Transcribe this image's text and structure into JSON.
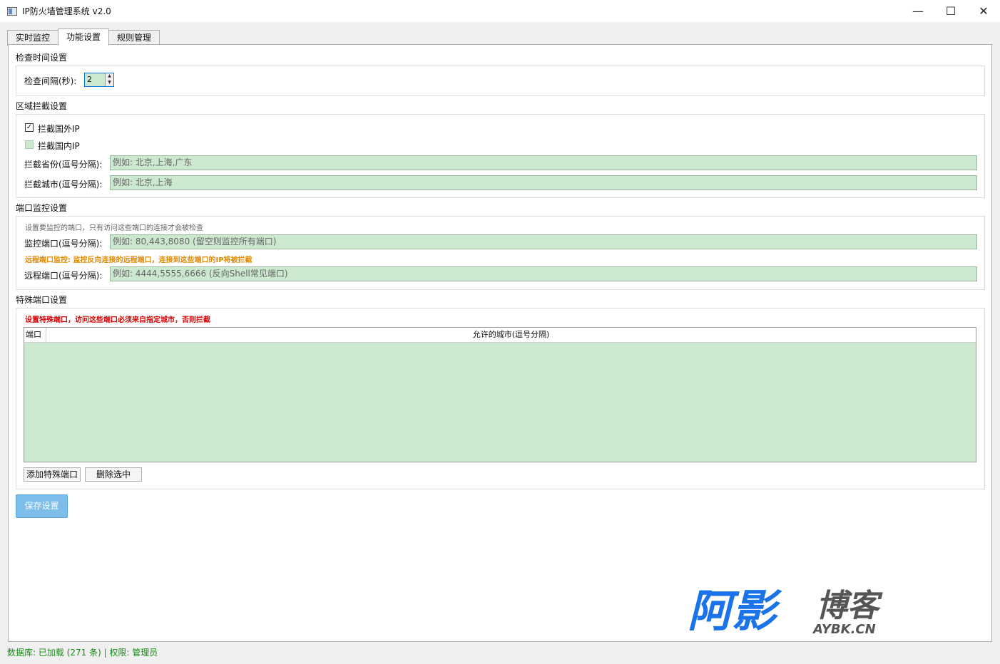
{
  "window": {
    "title": "IP防火墙管理系统 v2.0",
    "controls": {
      "minimize": "—",
      "maximize": "☐",
      "close": "✕"
    }
  },
  "tabs": [
    {
      "label": "实时监控",
      "active": false
    },
    {
      "label": "功能设置",
      "active": true
    },
    {
      "label": "规则管理",
      "active": false
    }
  ],
  "check_time": {
    "group_title": "检查时间设置",
    "interval_label": "检查间隔(秒):",
    "interval_value": "2"
  },
  "region_block": {
    "group_title": "区域拦截设置",
    "block_foreign": {
      "label": "拦截国外IP",
      "checked": true
    },
    "block_domestic": {
      "label": "拦截国内IP",
      "checked": false
    },
    "province_label": "拦截省份(逗号分隔):",
    "province_placeholder": "例如: 北京,上海,广东",
    "city_label": "拦截城市(逗号分隔):",
    "city_placeholder": "例如: 北京,上海"
  },
  "port_monitor": {
    "group_title": "端口监控设置",
    "hint": "设置要监控的端口，只有访问这些端口的连接才会被检查",
    "monitor_label": "监控端口(逗号分隔):",
    "monitor_placeholder": "例如: 80,443,8080 (留空则监控所有端口)",
    "remote_hint": "远程端口监控: 监控反向连接的远程端口，连接到这些端口的IP将被拦截",
    "remote_label": "远程端口(逗号分隔):",
    "remote_placeholder": "例如: 4444,5555,6666 (反向Shell常见端口)"
  },
  "special_port": {
    "group_title": "特殊端口设置",
    "warning": "设置特殊端口，访问这些端口必须来自指定城市，否则拦截",
    "columns": [
      "端口",
      "允许的城市(逗号分隔)"
    ],
    "rows": [],
    "add_button": "添加特殊端口",
    "delete_button": "删除选中"
  },
  "save_button": "保存设置",
  "watermark": {
    "main": "阿影博客",
    "sub": "AYBK.CN",
    "color": "#1a73e8"
  },
  "status_bar": "数据库: 已加载 (271 条) | 权限: 管理员"
}
